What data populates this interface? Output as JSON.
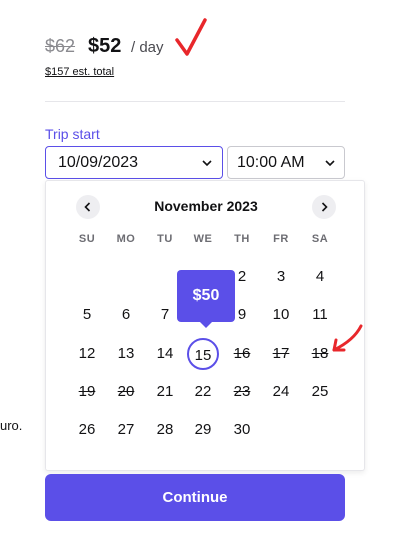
{
  "pricing": {
    "original_price": "$62",
    "current_price": "$52",
    "unit": "/ day",
    "total": "$157 est. total"
  },
  "trip": {
    "label": "Trip start",
    "date_value": "10/09/2023",
    "time_value": "10:00 AM"
  },
  "side_text": "uro.",
  "calendar": {
    "month": "November 2023",
    "weekdays": [
      "SU",
      "MO",
      "TU",
      "WE",
      "TH",
      "FR",
      "SA"
    ],
    "tooltip_price": "$50",
    "selected_day": "15",
    "weeks": [
      [
        "",
        "",
        "",
        "",
        "2",
        "3",
        "4"
      ],
      [
        "5",
        "6",
        "7",
        "",
        "9",
        "10",
        "11"
      ],
      [
        "12",
        "13",
        "14",
        "15",
        "16",
        "17",
        "18"
      ],
      [
        "19",
        "20",
        "21",
        "22",
        "23",
        "24",
        "25"
      ],
      [
        "26",
        "27",
        "28",
        "29",
        "30",
        "",
        ""
      ]
    ],
    "struck_days": [
      "16",
      "17",
      "18",
      "19",
      "20",
      "23"
    ]
  },
  "continue_label": "Continue",
  "colors": {
    "accent": "#5b4fe8",
    "annotation": "#e8272b"
  },
  "icons": {
    "prev": "chevron-left-icon",
    "next": "chevron-right-icon",
    "dropdown": "chevron-down-icon"
  }
}
